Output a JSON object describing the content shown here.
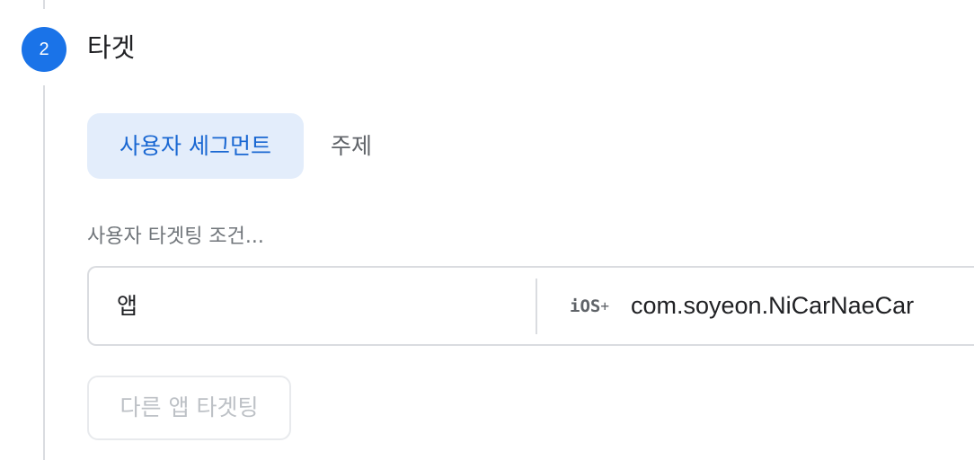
{
  "step": {
    "number": "2",
    "title": "타겟",
    "accent_color": "#1a73e8"
  },
  "tabs": [
    {
      "label": "사용자 세그먼트",
      "selected": true
    },
    {
      "label": "주제",
      "selected": false
    }
  ],
  "targeting": {
    "label": "사용자 타겟팅 조건...",
    "condition": {
      "key": "앱",
      "platform_icon": "ios-plus-icon",
      "platform_text": "iOS",
      "platform_suffix": "+",
      "value": "com.soyeon.NiCarNaeCar"
    }
  },
  "other_app_button": {
    "label": "다른 앱 타겟팅",
    "disabled": true
  }
}
